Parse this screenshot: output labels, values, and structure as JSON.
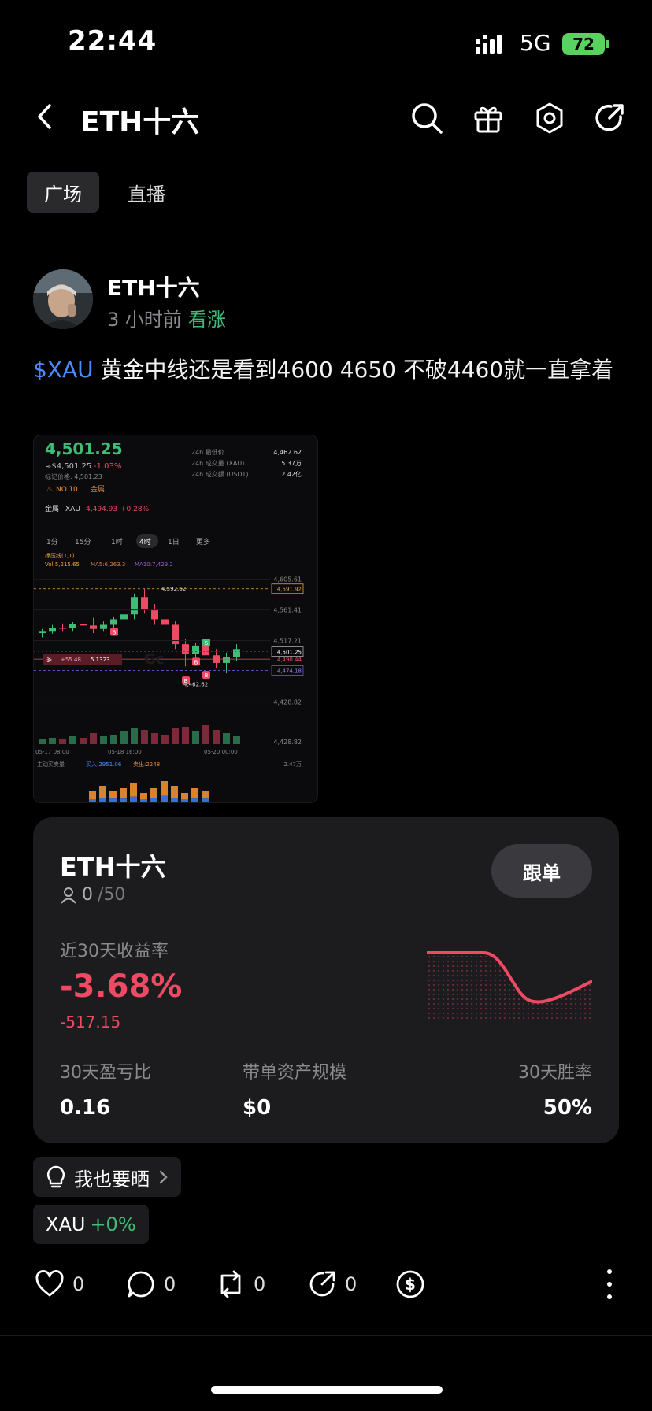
{
  "status_bar": {
    "time": "22:44",
    "network": "5G",
    "battery": "72"
  },
  "header": {
    "title": "ETH十六"
  },
  "tabs": [
    {
      "label": "广场"
    },
    {
      "label": "直播"
    }
  ],
  "post": {
    "author": "ETH十六",
    "time_ago": "3 小时前",
    "sentiment": "看涨",
    "ticker": "$XAU",
    "text": " 黄金中线还是看到4600  4650 不破4460就一直拿着",
    "chart_image": {
      "price": "4,501.25",
      "approx_price": "≈$4,501.25",
      "change": "-1.03%",
      "mark_price": "标记价格: 4,501.23",
      "rank": "NO.10",
      "rank_tag": "金属",
      "stats": [
        {
          "label": "24h 最低价",
          "value": "4,462.62"
        },
        {
          "label": "24h 成交量 (XAU)",
          "value": "5.37万"
        },
        {
          "label": "24h 成交额 (USDT)",
          "value": "2.42亿"
        }
      ],
      "related": {
        "label": "金属",
        "symbol": "XAU",
        "price": "4,494.93",
        "change": "+0.28%"
      },
      "timeframes": [
        "1分",
        "15分",
        "1时",
        "4时",
        "1日",
        "更多"
      ],
      "active_timeframe": "4时",
      "indicator": "撑压线(1,1)",
      "vol": "Vol:5,215.65",
      "ma5": "MA5:6,263.3",
      "ma10": "MA10:7,429.2",
      "price_axis": [
        "4,605.61",
        "4,561.41",
        "4,517.21",
        "4,428.82"
      ],
      "level_labels": {
        "high": "4,592.62",
        "resistance": "4,591.92",
        "current": "4,501.25",
        "mid": "4,490.44",
        "support": "4,474.18",
        "low": "4,462.62"
      },
      "position": {
        "side": "多",
        "pnl": "+55.48",
        "qty": "5.1323"
      },
      "x_labels": [
        "05-17 08:00",
        "05-18 16:00",
        "05-20 00:00"
      ],
      "flow": {
        "label": "主动买卖量",
        "buy": "买入:2951.06",
        "sell": "卖出:2248",
        "total": "2.47万"
      },
      "watermark": "Gc",
      "marker": "B",
      "sell_marker": "S"
    }
  },
  "card": {
    "name": "ETH十六",
    "followers": "0",
    "followers_max": "/50",
    "follow_label": "跟单",
    "roi_label": "近30天收益率",
    "roi": "-3.68%",
    "pnl": "-517.15",
    "stats": [
      {
        "label": "30天盈亏比",
        "value": "0.16"
      },
      {
        "label": "带单资产规模",
        "value": "$0"
      },
      {
        "label": "30天胜率",
        "value": "50%"
      }
    ]
  },
  "share_pill": {
    "label": "我也要晒"
  },
  "ticker_pill": {
    "symbol": "XAU",
    "change": "+0%"
  },
  "actions": {
    "likes": "0",
    "comments": "0",
    "reposts": "0",
    "shares": "0"
  },
  "colors": {
    "up": "#3fbd76",
    "down": "#ef4a64",
    "link": "#4a8cff",
    "card_bg": "#1c1c1e"
  }
}
